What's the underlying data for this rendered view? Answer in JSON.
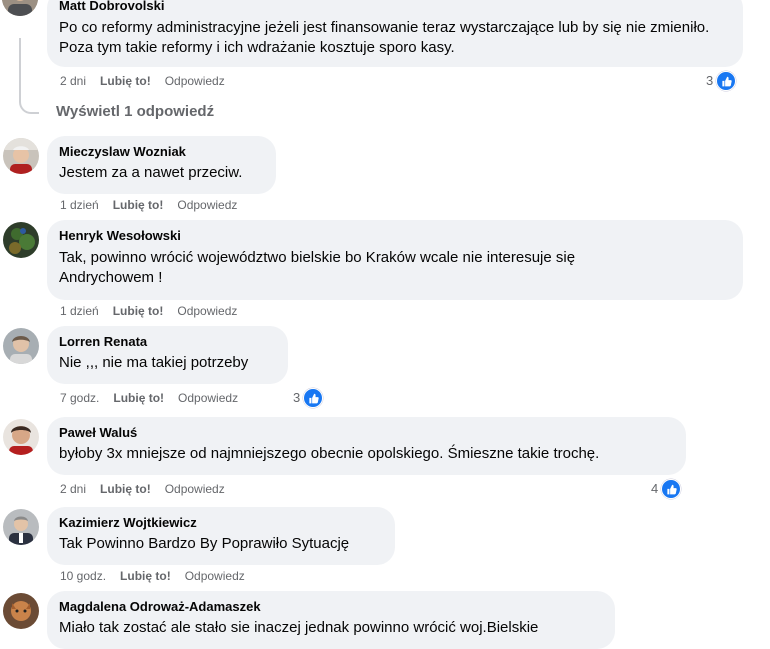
{
  "comments": [
    {
      "author": "Matt Dobrovolski",
      "text": "Po co reformy administracyjne jeżeli jest finansowanie teraz wystarczające lub by się nie zmieniło. Poza tym takie reformy i ich wdrażanie kosztuje sporo kasy.",
      "time": "2 dni",
      "like": "Lubię to!",
      "reply": "Odpowiedz",
      "reactions": "3"
    },
    {
      "author": "Mieczyslaw Wozniak",
      "text": "Jestem za a nawet przeciw.",
      "time": "1 dzień",
      "like": "Lubię to!",
      "reply": "Odpowiedz"
    },
    {
      "author": "Henryk Wesołowski",
      "text": "Tak, powinno wrócić województwo bielskie bo Kraków wcale nie interesuje się Andrychowem !",
      "time": "1 dzień",
      "like": "Lubię to!",
      "reply": "Odpowiedz"
    },
    {
      "author": "Lorren Renata",
      "text": "Nie ,,, nie ma takiej potrzeby",
      "time": "7 godz.",
      "like": "Lubię to!",
      "reply": "Odpowiedz",
      "reactions": "3"
    },
    {
      "author": "Paweł Waluś",
      "text": "byłoby 3x mniejsze od najmniejszego obecnie opolskiego. Śmieszne takie trochę.",
      "time": "2 dni",
      "like": "Lubię to!",
      "reply": "Odpowiedz",
      "reactions": "4"
    },
    {
      "author": "Kazimierz Wojtkiewicz",
      "text": "Tak Powinno Bardzo By Poprawiło Sytuację",
      "time": "10 godz.",
      "like": "Lubię to!",
      "reply": "Odpowiedz"
    },
    {
      "author": "Magdalena Odroważ-Adamaszek",
      "text": "Miało tak zostać ale stało sie inaczej jednak powinno wrócić woj.Bielskie"
    }
  ],
  "view_replies": "Wyświetl 1 odpowiedź",
  "icons": {
    "reaction": "like-reaction-icon",
    "reaction_color": "#1877f2"
  }
}
